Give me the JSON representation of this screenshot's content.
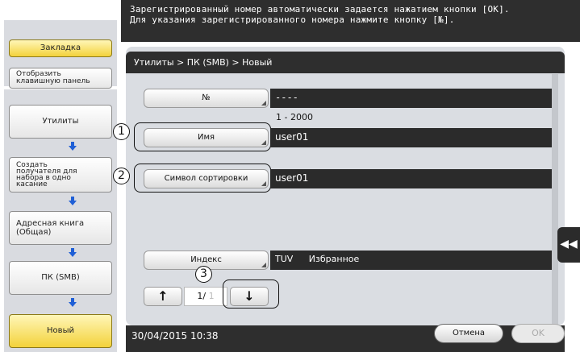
{
  "message": {
    "line1": "Зарегистрированный номер автоматически задается нажатием кнопки [OK].",
    "line2": "Для указания зарегистрированного номера нажмите кнопку [№]."
  },
  "sidebar": {
    "bookmark": "Закладка",
    "keypad_line1": "Отобразить",
    "keypad_line2": "клавишную панель",
    "flow": [
      {
        "label": "Утилиты"
      },
      {
        "label_lines": [
          "Создать",
          "получателя для",
          "набора в одно",
          "касание"
        ]
      },
      {
        "label_lines": [
          "Адресная книга",
          "(Общая)"
        ]
      },
      {
        "label": "ПК (SMB)"
      },
      {
        "label": "Новый"
      }
    ]
  },
  "breadcrumb": "Утилиты > ПК (SMB) > Новый",
  "form": {
    "number_button": "№",
    "number_value": "----",
    "number_range": "1 - 2000",
    "name_button": "Имя",
    "name_value": "user01",
    "sort_button": "Символ сортировки",
    "sort_value": "user01",
    "index_button": "Индекс",
    "index_value_1": "TUV",
    "index_value_2": "Избранное",
    "page_indicator": "1/",
    "page_total": "1",
    "up_arrow": "↑",
    "down_arrow": "↓"
  },
  "callouts": [
    "1",
    "2",
    "3"
  ],
  "footer": {
    "datetime": "30/04/2015   10:38",
    "cancel": "Отмена",
    "ok": "OK"
  },
  "side_handle": "◀◀",
  "colors": {
    "accent_yellow": "#f3d23b",
    "arrow_blue": "#1f5fd6",
    "dark": "#2e2e2e",
    "panel": "#dadde2"
  }
}
